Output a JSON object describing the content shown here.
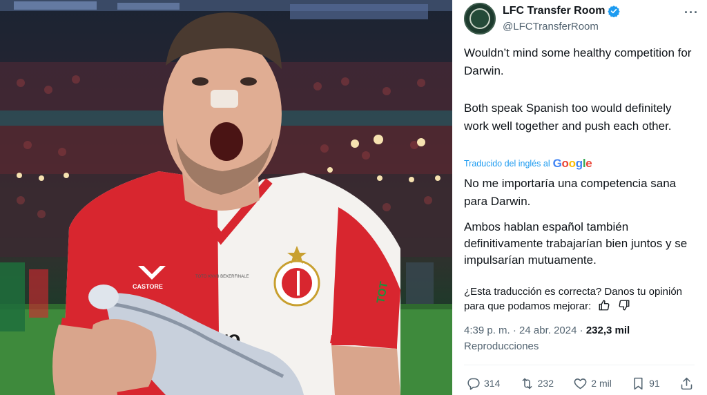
{
  "photo": {
    "description_icon": "football-player-celebration-photo",
    "shirt_sponsor": "CASTORE",
    "crest_text": "FEYENOORD ROTTERDAM",
    "sleeve_text": "TOT",
    "chest_text": "uro",
    "embroidery": "TOTO KNVB BEKERFINALE"
  },
  "tweet": {
    "display_name": "LFC Transfer Room",
    "handle": "@LFCTransferRoom",
    "text_en_1": "Wouldn’t mind some healthy competition for Darwin.",
    "text_en_2": "Both speak Spanish too would definitely work well together and push each other.",
    "translated_label": "Traducido del inglés al",
    "translated_brand": "Google",
    "text_es_1": "No me importaría una competencia sana para Darwin.",
    "text_es_2": "Ambos hablan español también definitivamente trabajarían bien juntos y se impulsarían mutuamente.",
    "feedback_text": "¿Esta traducción es correcta? Danos tu opinión para que podamos mejorar:",
    "time": "4:39 p. m.",
    "date": "24 abr. 2024",
    "views": "232,3 mil",
    "views_label": "Reproducciones",
    "separator": "·",
    "replies": "314",
    "retweets": "232",
    "likes": "2 mil",
    "bookmarks": "91",
    "more_label": "···"
  },
  "colors": {
    "accent_blue": "#1d9bf0",
    "text_primary": "#0f1419",
    "text_secondary": "#536471",
    "feyenoord_red": "#d8262f"
  }
}
